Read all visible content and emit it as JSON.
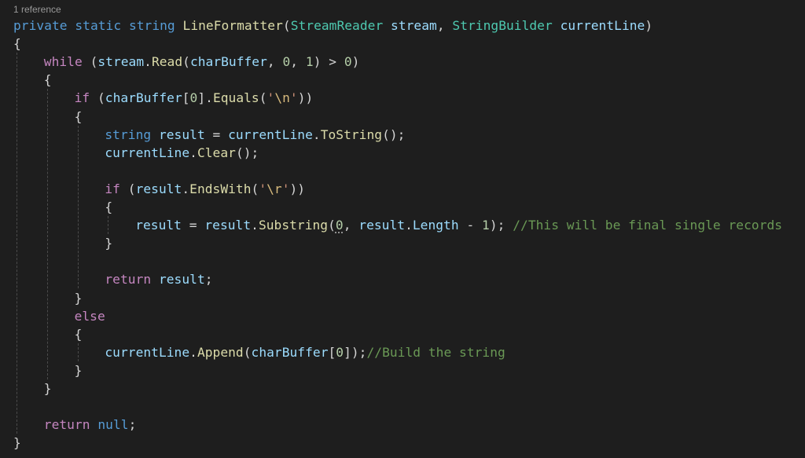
{
  "editor": {
    "codelens": "1 reference",
    "lines": [
      {
        "indent": 0,
        "tokens": [
          {
            "t": "private",
            "c": "kw"
          },
          {
            "t": " "
          },
          {
            "t": "static",
            "c": "kw"
          },
          {
            "t": " "
          },
          {
            "t": "string",
            "c": "kw"
          },
          {
            "t": " "
          },
          {
            "t": "LineFormatter",
            "c": "fn"
          },
          {
            "t": "(",
            "c": "punc"
          },
          {
            "t": "StreamReader",
            "c": "type"
          },
          {
            "t": " "
          },
          {
            "t": "stream",
            "c": "var"
          },
          {
            "t": ", ",
            "c": "punc"
          },
          {
            "t": "StringBuilder",
            "c": "type"
          },
          {
            "t": " "
          },
          {
            "t": "currentLine",
            "c": "var"
          },
          {
            "t": ")",
            "c": "punc"
          }
        ]
      },
      {
        "indent": 0,
        "tokens": [
          {
            "t": "{",
            "c": "punc"
          }
        ]
      },
      {
        "indent": 1,
        "tokens": [
          {
            "t": "while",
            "c": "ctl"
          },
          {
            "t": " ("
          },
          {
            "t": "stream",
            "c": "var"
          },
          {
            "t": "."
          },
          {
            "t": "Read",
            "c": "fn"
          },
          {
            "t": "("
          },
          {
            "t": "charBuffer",
            "c": "var"
          },
          {
            "t": ", "
          },
          {
            "t": "0",
            "c": "num"
          },
          {
            "t": ", "
          },
          {
            "t": "1",
            "c": "num"
          },
          {
            "t": ") > "
          },
          {
            "t": "0",
            "c": "num"
          },
          {
            "t": ")"
          }
        ]
      },
      {
        "indent": 1,
        "tokens": [
          {
            "t": "{"
          }
        ]
      },
      {
        "indent": 2,
        "tokens": [
          {
            "t": "if",
            "c": "ctl"
          },
          {
            "t": " ("
          },
          {
            "t": "charBuffer",
            "c": "var"
          },
          {
            "t": "["
          },
          {
            "t": "0",
            "c": "num"
          },
          {
            "t": "]."
          },
          {
            "t": "Equals",
            "c": "fn"
          },
          {
            "t": "("
          },
          {
            "t": "'",
            "c": "str"
          },
          {
            "t": "\\n",
            "c": "esc"
          },
          {
            "t": "'",
            "c": "str"
          },
          {
            "t": "))"
          }
        ]
      },
      {
        "indent": 2,
        "tokens": [
          {
            "t": "{"
          }
        ]
      },
      {
        "indent": 3,
        "tokens": [
          {
            "t": "string",
            "c": "kw"
          },
          {
            "t": " "
          },
          {
            "t": "result",
            "c": "var"
          },
          {
            "t": " = "
          },
          {
            "t": "currentLine",
            "c": "var"
          },
          {
            "t": "."
          },
          {
            "t": "ToString",
            "c": "fn"
          },
          {
            "t": "();"
          }
        ]
      },
      {
        "indent": 3,
        "tokens": [
          {
            "t": "currentLine",
            "c": "var"
          },
          {
            "t": "."
          },
          {
            "t": "Clear",
            "c": "fn"
          },
          {
            "t": "();"
          }
        ]
      },
      {
        "indent": 3,
        "tokens": []
      },
      {
        "indent": 3,
        "tokens": [
          {
            "t": "if",
            "c": "ctl"
          },
          {
            "t": " ("
          },
          {
            "t": "result",
            "c": "var"
          },
          {
            "t": "."
          },
          {
            "t": "EndsWith",
            "c": "fn"
          },
          {
            "t": "("
          },
          {
            "t": "'",
            "c": "str"
          },
          {
            "t": "\\r",
            "c": "esc"
          },
          {
            "t": "'",
            "c": "str"
          },
          {
            "t": "))"
          }
        ]
      },
      {
        "indent": 3,
        "tokens": [
          {
            "t": "{"
          }
        ]
      },
      {
        "indent": 4,
        "tokens": [
          {
            "t": "result",
            "c": "var"
          },
          {
            "t": " = "
          },
          {
            "t": "result",
            "c": "var"
          },
          {
            "t": "."
          },
          {
            "t": "Substring",
            "c": "fn"
          },
          {
            "t": "("
          },
          {
            "t": "0",
            "c": "num hint"
          },
          {
            "t": ", "
          },
          {
            "t": "result",
            "c": "var"
          },
          {
            "t": "."
          },
          {
            "t": "Length",
            "c": "var"
          },
          {
            "t": " - "
          },
          {
            "t": "1",
            "c": "num"
          },
          {
            "t": "); "
          },
          {
            "t": "//This will be final single records",
            "c": "cmt"
          }
        ]
      },
      {
        "indent": 3,
        "tokens": [
          {
            "t": "}"
          }
        ]
      },
      {
        "indent": 3,
        "tokens": []
      },
      {
        "indent": 3,
        "tokens": [
          {
            "t": "return",
            "c": "ctl"
          },
          {
            "t": " "
          },
          {
            "t": "result",
            "c": "var"
          },
          {
            "t": ";"
          }
        ]
      },
      {
        "indent": 2,
        "tokens": [
          {
            "t": "}"
          }
        ]
      },
      {
        "indent": 2,
        "tokens": [
          {
            "t": "else",
            "c": "ctl"
          }
        ]
      },
      {
        "indent": 2,
        "tokens": [
          {
            "t": "{"
          }
        ]
      },
      {
        "indent": 3,
        "tokens": [
          {
            "t": "currentLine",
            "c": "var"
          },
          {
            "t": "."
          },
          {
            "t": "Append",
            "c": "fn"
          },
          {
            "t": "("
          },
          {
            "t": "charBuffer",
            "c": "var"
          },
          {
            "t": "["
          },
          {
            "t": "0",
            "c": "num"
          },
          {
            "t": "]);"
          },
          {
            "t": "//Build the string",
            "c": "cmt"
          }
        ]
      },
      {
        "indent": 2,
        "tokens": [
          {
            "t": "}"
          }
        ]
      },
      {
        "indent": 1,
        "tokens": [
          {
            "t": "}"
          }
        ]
      },
      {
        "indent": 1,
        "tokens": []
      },
      {
        "indent": 1,
        "tokens": [
          {
            "t": "return",
            "c": "ctl"
          },
          {
            "t": " "
          },
          {
            "t": "null",
            "c": "kw"
          },
          {
            "t": ";"
          }
        ]
      },
      {
        "indent": 0,
        "tokens": [
          {
            "t": "}"
          }
        ]
      }
    ]
  }
}
